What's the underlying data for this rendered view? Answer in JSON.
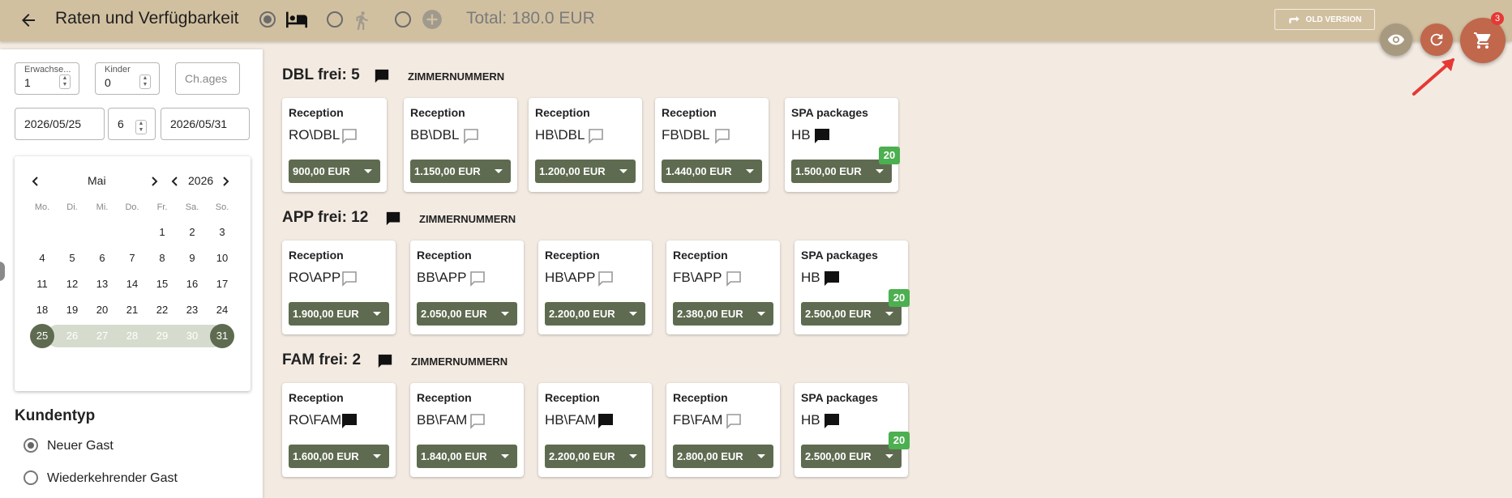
{
  "header": {
    "title": "Raten und Verfügbarkeit",
    "total": "Total: 180.0 EUR",
    "old_version": "OLD VERSION",
    "cart_count": "3",
    "mode_options": [
      {
        "icon": "bed-icon",
        "selected": true
      },
      {
        "icon": "walking-icon",
        "selected": false
      },
      {
        "icon": "add-circle-icon",
        "selected": false
      }
    ]
  },
  "form": {
    "adults_label": "Erwachse...",
    "adults_value": "1",
    "children_label": "Kinder",
    "children_value": "0",
    "child_ages_placeholder": "Ch.ages",
    "arrival": "2026/05/25",
    "nights": "6",
    "departure": "2026/05/31"
  },
  "calendar": {
    "month": "Mai",
    "year": "2026",
    "weekdays": [
      "Mo.",
      "Di.",
      "Mi.",
      "Do.",
      "Fr.",
      "Sa.",
      "So."
    ],
    "weeks": [
      [
        "",
        "",
        "",
        "",
        "1",
        "2",
        "3"
      ],
      [
        "4",
        "5",
        "6",
        "7",
        "8",
        "9",
        "10"
      ],
      [
        "11",
        "12",
        "13",
        "14",
        "15",
        "16",
        "17"
      ],
      [
        "18",
        "19",
        "20",
        "21",
        "22",
        "23",
        "24"
      ],
      [
        "25",
        "26",
        "27",
        "28",
        "29",
        "30",
        "31"
      ]
    ],
    "range_start": "25",
    "range_end": "31"
  },
  "customer_type": {
    "title": "Kundentyp",
    "options": [
      {
        "label": "Neuer Gast",
        "selected": true
      },
      {
        "label": "Wiederkehrender Gast",
        "selected": false
      }
    ]
  },
  "room_zimmer_label": "ZIMMERNUMMERN",
  "rooms": [
    {
      "title": "DBL frei: 5",
      "rates": [
        {
          "category": "Reception",
          "code": "RO\\DBL",
          "comment_filled": false,
          "price": "900,00 EUR",
          "count": ""
        },
        {
          "category": "Reception",
          "code": "BB\\DBL",
          "comment_filled": false,
          "price": "1.150,00 EUR",
          "count": ""
        },
        {
          "category": "Reception",
          "code": "HB\\DBL",
          "comment_filled": false,
          "price": "1.200,00 EUR",
          "count": ""
        },
        {
          "category": "Reception",
          "code": "FB\\DBL",
          "comment_filled": false,
          "price": "1.440,00 EUR",
          "count": ""
        },
        {
          "category": "SPA packages",
          "code": "HB",
          "comment_filled": true,
          "price": "1.500,00 EUR",
          "count": "20"
        }
      ]
    },
    {
      "title": "APP frei: 12",
      "rates": [
        {
          "category": "Reception",
          "code": "RO\\APP",
          "comment_filled": false,
          "price": "1.900,00 EUR",
          "count": ""
        },
        {
          "category": "Reception",
          "code": "BB\\APP",
          "comment_filled": false,
          "price": "2.050,00 EUR",
          "count": ""
        },
        {
          "category": "Reception",
          "code": "HB\\APP",
          "comment_filled": false,
          "price": "2.200,00 EUR",
          "count": ""
        },
        {
          "category": "Reception",
          "code": "FB\\APP",
          "comment_filled": false,
          "price": "2.380,00 EUR",
          "count": ""
        },
        {
          "category": "SPA packages",
          "code": "HB",
          "comment_filled": true,
          "price": "2.500,00 EUR",
          "count": "20"
        }
      ]
    },
    {
      "title": "FAM frei: 2",
      "rates": [
        {
          "category": "Reception",
          "code": "RO\\FAM",
          "comment_filled": true,
          "price": "1.600,00 EUR",
          "count": ""
        },
        {
          "category": "Reception",
          "code": "BB\\FAM",
          "comment_filled": false,
          "price": "1.840,00 EUR",
          "count": ""
        },
        {
          "category": "Reception",
          "code": "HB\\FAM",
          "comment_filled": true,
          "price": "2.200,00 EUR",
          "count": ""
        },
        {
          "category": "Reception",
          "code": "FB\\FAM",
          "comment_filled": false,
          "price": "2.800,00 EUR",
          "count": ""
        },
        {
          "category": "SPA packages",
          "code": "HB",
          "comment_filled": true,
          "price": "2.500,00 EUR",
          "count": "20"
        }
      ]
    }
  ],
  "colors": {
    "header": "#d1c0a0",
    "background": "#f3ebe2",
    "price_button": "#5f6b50",
    "count_badge": "#4caf50",
    "cart_fab": "#c0674c",
    "view_fab": "#a89a80"
  }
}
